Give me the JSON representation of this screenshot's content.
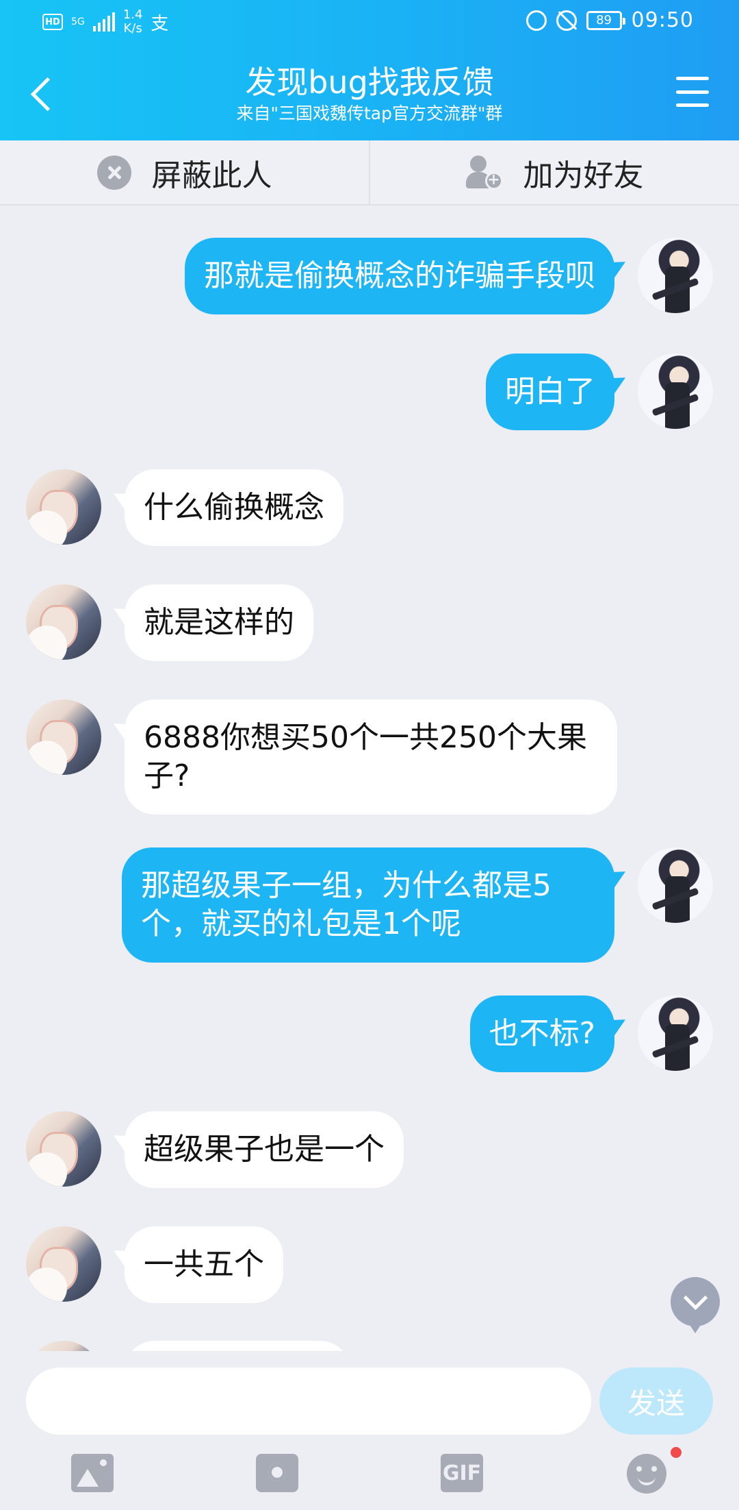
{
  "status_bar": {
    "hd": "HD",
    "network_type": "5G",
    "speed_value": "1.4",
    "speed_unit": "K/s",
    "extra_icon": "支",
    "battery": "89",
    "time": "09:50"
  },
  "header": {
    "title": "发现bug找我反馈",
    "subtitle": "来自\"三国戏魏传tap官方交流群\"群"
  },
  "actions": {
    "block": "屏蔽此人",
    "add_friend": "加为好友"
  },
  "messages": [
    {
      "from": "me",
      "text": "那就是偷换概念的诈骗手段呗"
    },
    {
      "from": "me",
      "text": "明白了"
    },
    {
      "from": "other",
      "text": "什么偷换概念"
    },
    {
      "from": "other",
      "text": "就是这样的"
    },
    {
      "from": "other",
      "text": "6888你想买50个一共250个大果子?"
    },
    {
      "from": "me",
      "text": "那超级果子一组，为什么都是5个，就买的礼包是1个呢"
    },
    {
      "from": "me",
      "text": "也不标?"
    },
    {
      "from": "other",
      "text": "超级果子也是一个"
    },
    {
      "from": "other",
      "text": "一共五个"
    }
  ],
  "input": {
    "placeholder": "",
    "send_label": "发送"
  },
  "toolbar": {
    "icons": [
      "image-icon",
      "camera-icon",
      "gif-icon",
      "emoji-icon"
    ],
    "gif_label": "GIF"
  },
  "colors": {
    "header_accent": "#1ab3f5",
    "my_bubble": "#1eb5f5",
    "other_bubble": "#ffffff",
    "send_button": "#bde8fb",
    "notification_dot": "#f04a4a"
  }
}
